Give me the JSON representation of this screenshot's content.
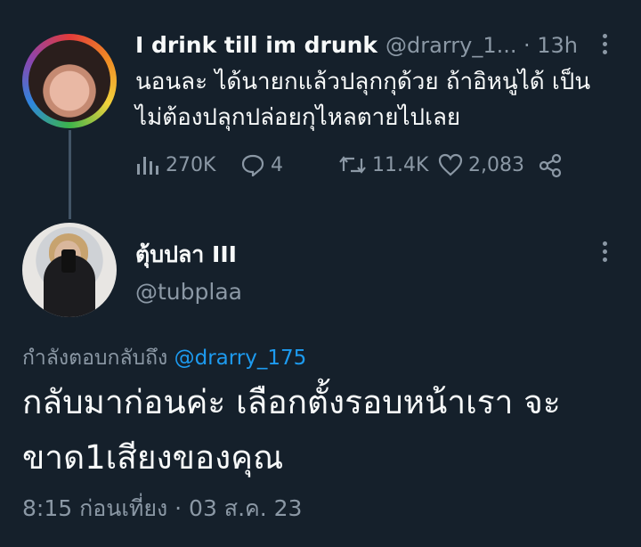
{
  "tweet": {
    "display_name": "I drink till im drunk",
    "handle": "@drarry_1...",
    "time": "· 13h",
    "text": "นอนละ ได้นายกแล้วปลุกกุด้วย ถ้าอิหนูได้ เป็นไม่ต้องปลุกปล่อยกุไหลตายไปเลย",
    "views": "270K",
    "replies": "4",
    "retweets": "11.4K",
    "likes": "2,083",
    "icons": [
      "views-icon",
      "reply-icon",
      "retweet-icon",
      "like-icon",
      "share-icon",
      "more-icon"
    ]
  },
  "reply": {
    "display_name": "ตุ้บปลา III",
    "handle": "@tubplaa",
    "replying_prefix": "กำลังตอบกลับถึง",
    "replying_to": "@drarry_175",
    "text": "กลับมาก่อนค่ะ เลือกตั้งรอบหน้าเรา จะขาด1เสียงของคุณ",
    "timestamp": "8:15 ก่อนเที่ยง · 03 ส.ค. 23"
  },
  "colors": {
    "background": "#15202b",
    "text": "#f7f9f9",
    "secondary": "#8b98a5",
    "link": "#1d9bf0",
    "thread_line": "#425466"
  }
}
